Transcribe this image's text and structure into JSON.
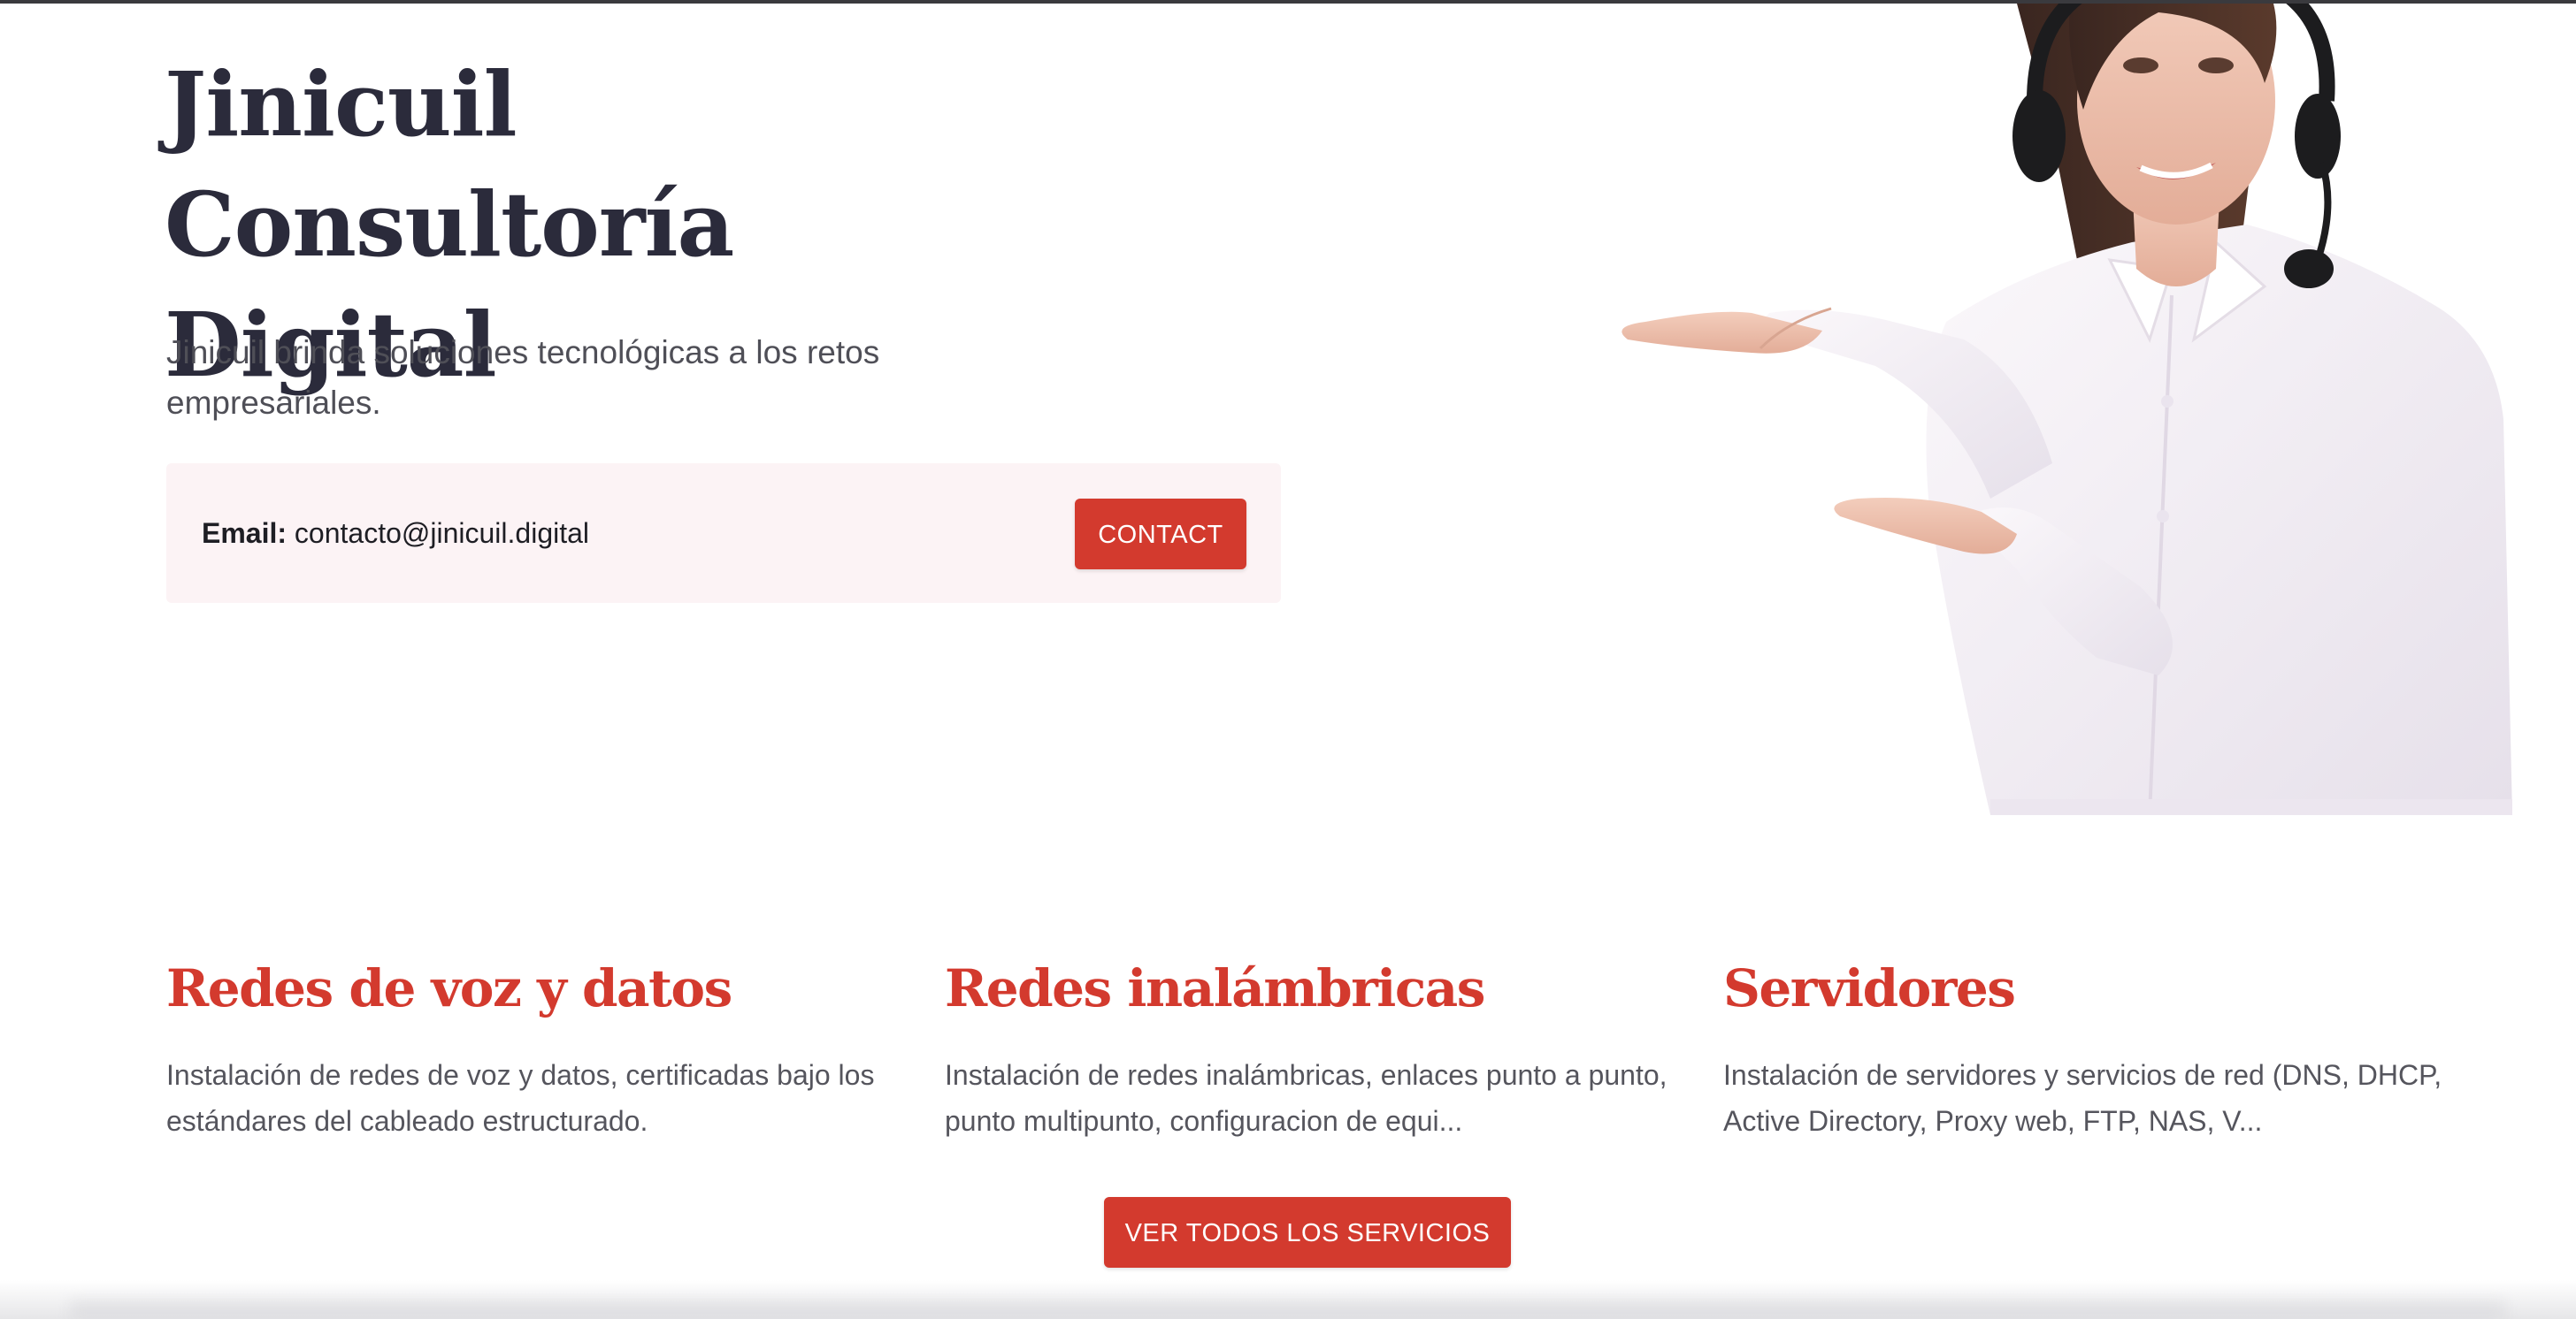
{
  "hero": {
    "title": "Jinicuil Consultoría Digital",
    "subtitle": "Jinicuil brinda soluciones tecnológicas a los retos empresariales.",
    "email_label": "Email:",
    "email_value": "contacto@jinicuil.digital",
    "contact_button": "CONTACT",
    "image": "customer-support-woman-headset-presenting"
  },
  "services": [
    {
      "title": "Redes de voz y datos",
      "description": "Instalación de redes de voz y datos, certificadas bajo los estándares del cableado estructurado."
    },
    {
      "title": "Redes inalámbricas",
      "description": "Instalación de redes inalámbricas, enlaces punto a punto, punto multipunto, configuracion de equi..."
    },
    {
      "title": "Servidores",
      "description": "Instalación de servidores y servicios de red (DNS, DHCP, Active Directory, Proxy web, FTP, NAS, V..."
    }
  ],
  "all_services_button": "VER TODOS LOS SERVICIOS",
  "colors": {
    "accent": "#d33a2e",
    "heading": "#2b2b3b",
    "body_text": "#4f4f57",
    "contact_box_bg": "#fcf3f5"
  }
}
